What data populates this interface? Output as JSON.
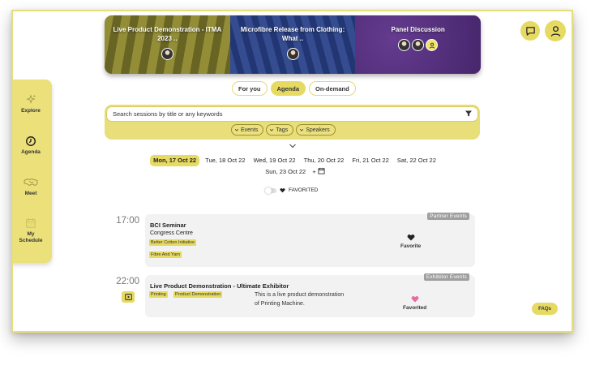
{
  "banner": {
    "items": [
      {
        "title": "Live Product Demonstration - ITMA 2023 ..",
        "speakers": 1
      },
      {
        "title": "Microfibre Release from Clothing: What ..",
        "speakers": 1
      },
      {
        "title": "Panel Discussion",
        "speakers": 3
      }
    ]
  },
  "header": {
    "chat_icon": "chat-bubble-icon",
    "profile_icon": "user-icon"
  },
  "sidebar": {
    "items": [
      {
        "label": "Explore",
        "icon": "sparkle-icon"
      },
      {
        "label": "Agenda",
        "icon": "clock-icon"
      },
      {
        "label": "Meet",
        "icon": "handshake-icon"
      },
      {
        "label": "My Schedule",
        "icon": "calendar-icon"
      }
    ]
  },
  "tabs": {
    "items": [
      {
        "label": "For you"
      },
      {
        "label": "Agenda",
        "active": true
      },
      {
        "label": "On-demand"
      }
    ]
  },
  "search": {
    "placeholder": "Search sessions by title or any keywords",
    "filters": [
      {
        "label": "Events"
      },
      {
        "label": "Tags"
      },
      {
        "label": "Speakers"
      }
    ]
  },
  "dates": {
    "items": [
      {
        "label": "Mon, 17 Oct 22",
        "active": true
      },
      {
        "label": "Tue, 18 Oct 22"
      },
      {
        "label": "Wed, 19 Oct 22"
      },
      {
        "label": "Thu, 20 Oct 22"
      },
      {
        "label": "Fri, 21 Oct 22"
      },
      {
        "label": "Sat, 22 Oct 22"
      },
      {
        "label": "Sun, 23 Oct 22"
      }
    ],
    "add_label": "+"
  },
  "favorited_filter": {
    "label": "FAVORITED",
    "on": false
  },
  "sessions": [
    {
      "time": "17:00",
      "category": "Partner Events",
      "title": "BCI Seminar",
      "location": "Congress Centre",
      "tags": [
        "Better Cotton Initiative",
        "Fibre And Yarn"
      ],
      "fav_label": "Favorite",
      "fav_color": "#222222"
    },
    {
      "time": "22:00",
      "category": "Exhibitor Events",
      "title": "Live Product Demonstration - Ultimate Exhibitor",
      "tags": [
        "Printing",
        "Product Demonstration"
      ],
      "description_line1": "This is a live product demonstration",
      "description_line2": "of Printing Machine.",
      "fav_label": "Favorited",
      "fav_color": "#e86ca4"
    }
  ],
  "faqs_label": "FAQs",
  "colors": {
    "accent": "#e6da63",
    "border": "#e6de7a"
  }
}
